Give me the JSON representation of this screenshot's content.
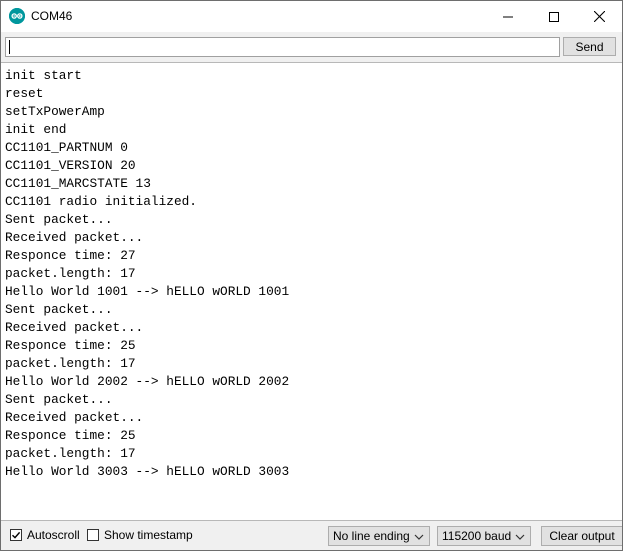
{
  "window": {
    "title": "COM46",
    "icon": "arduino-icon",
    "controls": [
      "minimize-icon",
      "maximize-icon",
      "close-icon"
    ]
  },
  "input": {
    "value": "",
    "send_label": "Send"
  },
  "output": {
    "lines": [
      "init start",
      "reset",
      "setTxPowerAmp",
      "init end",
      "CC1101_PARTNUM 0",
      "CC1101_VERSION 20",
      "CC1101_MARCSTATE 13",
      "CC1101 radio initialized.",
      "Sent packet...",
      "Received packet...",
      "Responce time: 27",
      "packet.length: 17",
      "Hello World 1001 --> hELLO wORLD 1001",
      "Sent packet...",
      "Received packet...",
      "Responce time: 25",
      "packet.length: 17",
      "Hello World 2002 --> hELLO wORLD 2002",
      "Sent packet...",
      "Received packet...",
      "Responce time: 25",
      "packet.length: 17",
      "Hello World 3003 --> hELLO wORLD 3003"
    ]
  },
  "footer": {
    "autoscroll_label": "Autoscroll",
    "autoscroll_checked": true,
    "timestamp_label": "Show timestamp",
    "timestamp_checked": false,
    "line_ending": "No line ending",
    "baud": "115200 baud",
    "clear_label": "Clear output"
  },
  "colors": {
    "accent": "#00979d",
    "chrome": "#f0f0f0",
    "button": "#e1e1e1"
  }
}
